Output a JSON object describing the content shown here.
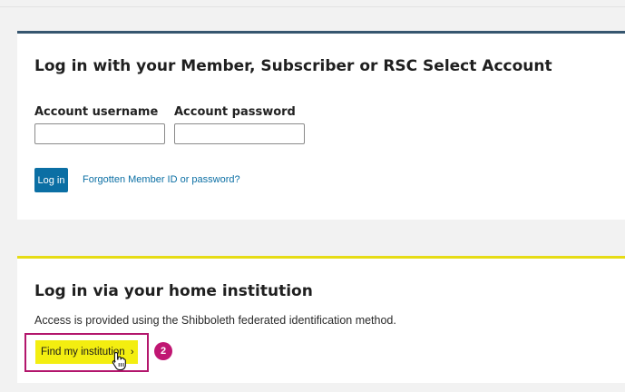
{
  "member_section": {
    "title": "Log in with your Member, Subscriber or RSC Select Account",
    "username_label": "Account username",
    "password_label": "Account password",
    "username_value": "",
    "password_value": "",
    "login_button": "Log in",
    "forgot_link": "Forgotten Member ID or password?"
  },
  "institution_section": {
    "title": "Log in via your home institution",
    "description": "Access is provided using the Shibboleth federated identification method.",
    "find_button": "Find my institution",
    "find_chevron": "›",
    "step_badge": "2"
  },
  "colors": {
    "member_accent": "#36566f",
    "institution_accent": "#e6dc15",
    "primary_button": "#0b6fa4",
    "find_button": "#f3ee10",
    "annotation": "#c01672"
  },
  "icons": {
    "cursor": "hand-pointer-icon",
    "chevron": "chevron-right-icon"
  }
}
